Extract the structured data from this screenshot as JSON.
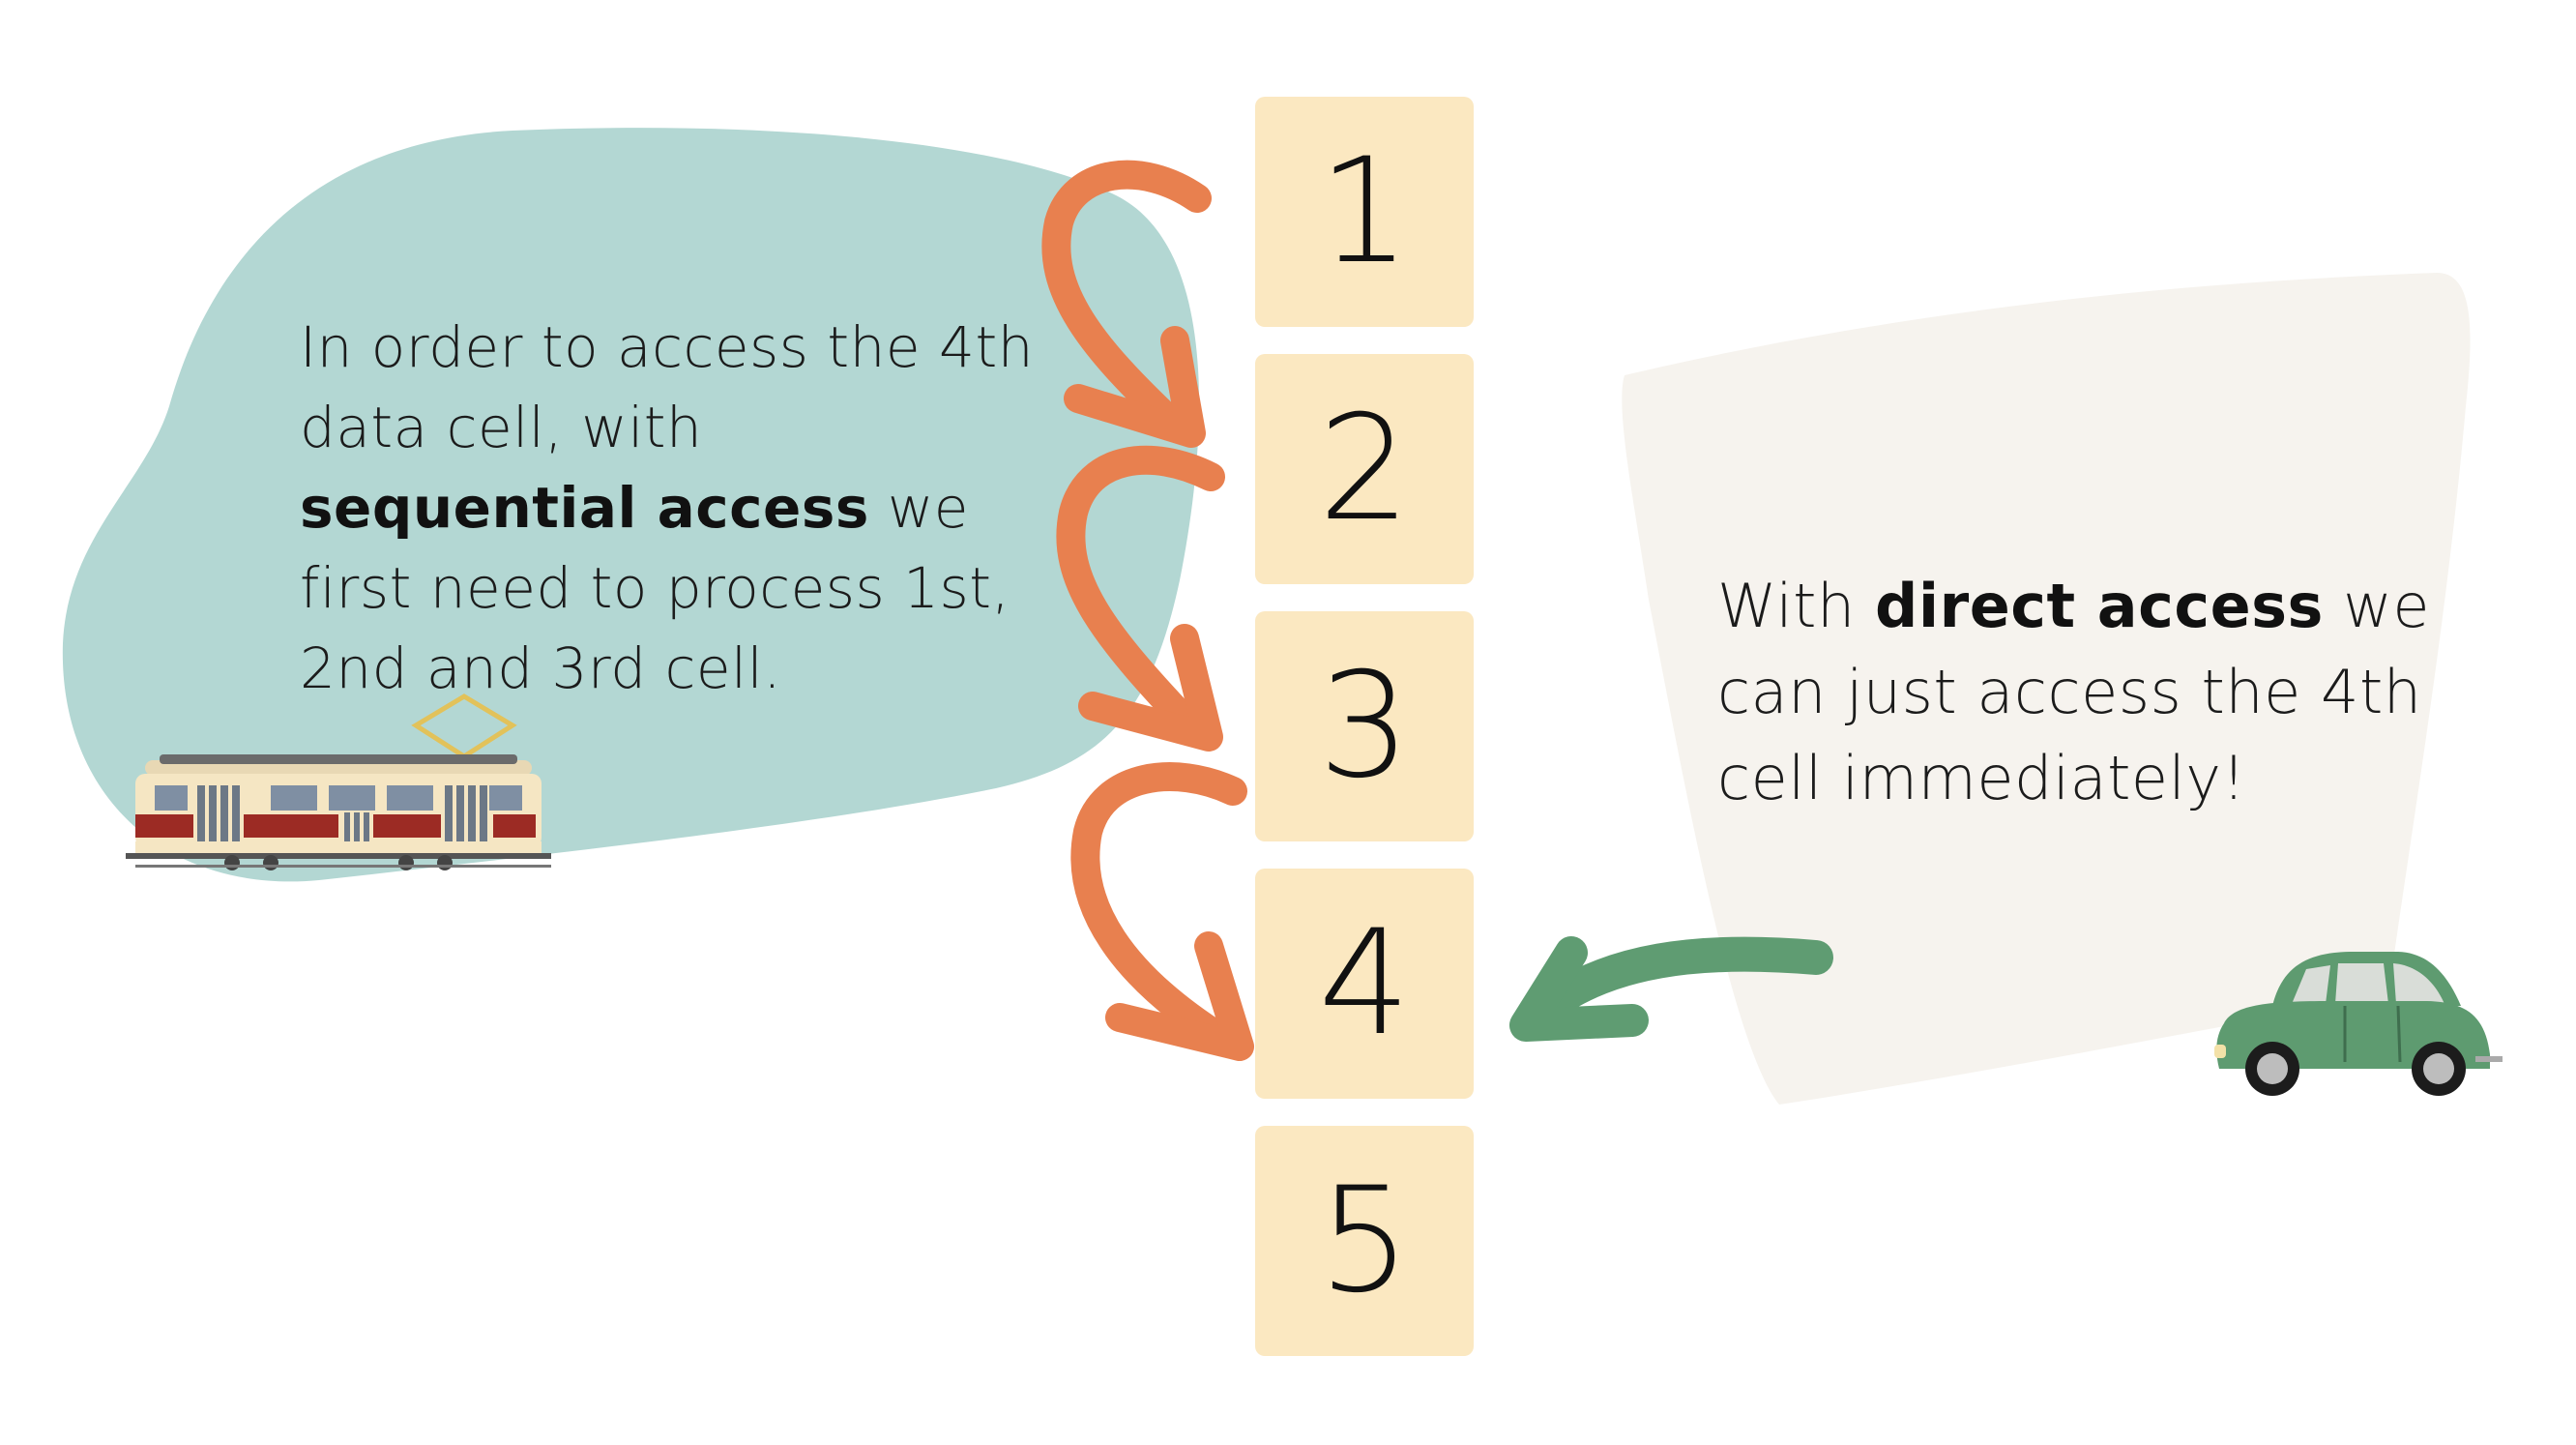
{
  "cells": [
    "1",
    "2",
    "3",
    "4",
    "5"
  ],
  "sequential_text": {
    "before": "In order to access the 4th data cell, with",
    "bold": "sequential access",
    "after": "we first need to process 1st, 2nd and 3rd cell."
  },
  "direct_text": {
    "before": "With",
    "bold": "direct access",
    "after": "we can just access the 4th cell immediately!"
  },
  "colors": {
    "teal_blob": "#b3d7d3",
    "beige_blob": "#f6f3ee",
    "cell_fill": "#fbe8c1",
    "orange_arrow": "#e8804f",
    "green_arrow": "#5f9c72",
    "car_body": "#5e9b70",
    "tram_red": "#9c2b24",
    "tram_cream": "#f5e6c3"
  },
  "icons": [
    "tram-icon",
    "car-icon",
    "curved-arrow-icon",
    "direct-arrow-icon"
  ]
}
